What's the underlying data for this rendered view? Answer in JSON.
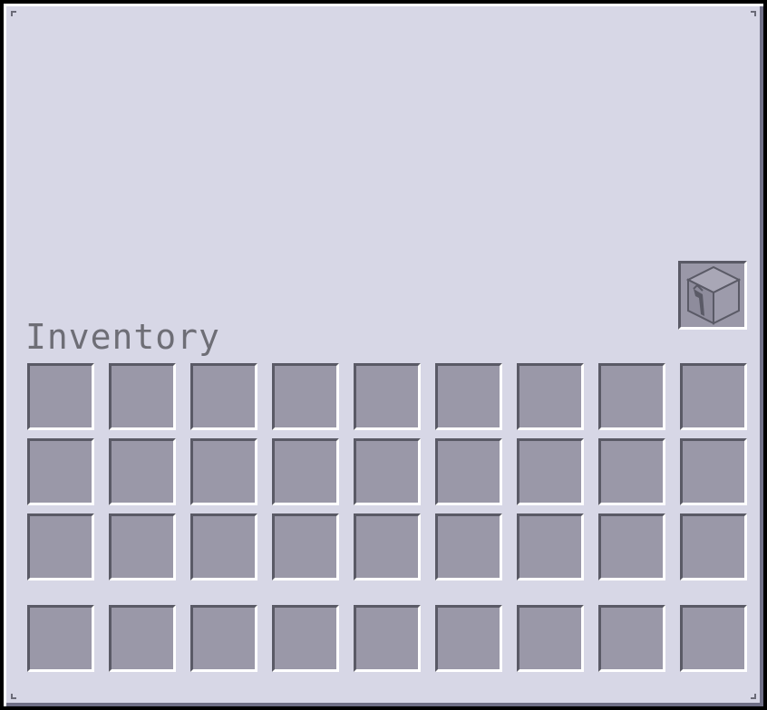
{
  "window": {
    "title": "Inventory"
  },
  "special_slot": {
    "icon": "crafting-box-icon"
  },
  "grid": {
    "columns": 9,
    "main_rows": 3,
    "hotbar_rows": 1
  },
  "colors": {
    "panel_bg": "#d7d7e6",
    "slot_bg": "#9a98a8",
    "title_text": "#6e6e76"
  }
}
